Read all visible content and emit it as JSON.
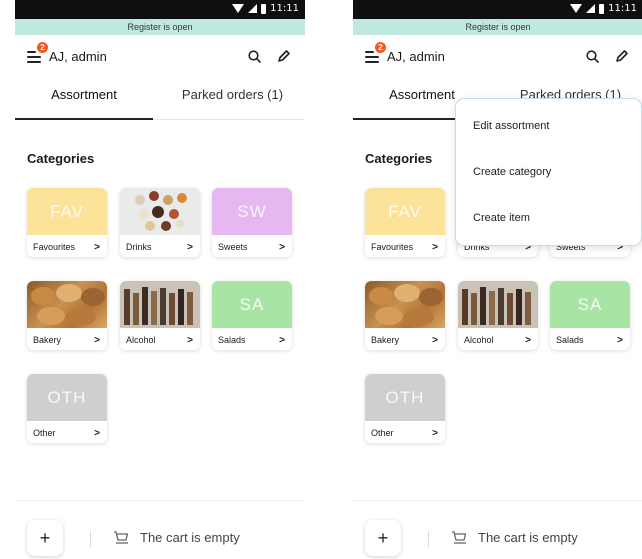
{
  "status_bar": {
    "time": "11:11"
  },
  "banner": {
    "text": "Register is open"
  },
  "header": {
    "user": "AJ, admin",
    "badge_count": "2"
  },
  "tabs": [
    {
      "label": "Assortment"
    },
    {
      "label": "Parked orders (1)"
    }
  ],
  "section_title": "Categories",
  "categories": [
    {
      "label": "Favourites",
      "tile_text": "FAV",
      "color": "#fde39a"
    },
    {
      "label": "Drinks",
      "tile_text": ""
    },
    {
      "label": "Sweets",
      "tile_text": "SW",
      "color": "#e6b7f0"
    },
    {
      "label": "Bakery",
      "tile_text": ""
    },
    {
      "label": "Alcohol",
      "tile_text": ""
    },
    {
      "label": "Salads",
      "tile_text": "SA",
      "color": "#a8e4a4"
    },
    {
      "label": "Other",
      "tile_text": "OTH",
      "color": "#cfcfcf"
    }
  ],
  "chevron": ">",
  "bottom": {
    "plus": "+",
    "cart_text": "The cart is empty"
  },
  "dropdown": {
    "items": [
      {
        "label": "Edit assortment"
      },
      {
        "label": "Create category"
      },
      {
        "label": "Create item"
      }
    ]
  },
  "icons": [
    "menu-icon",
    "search-icon",
    "pencil-icon",
    "cart-icon",
    "signal-icon",
    "battery-icon"
  ]
}
